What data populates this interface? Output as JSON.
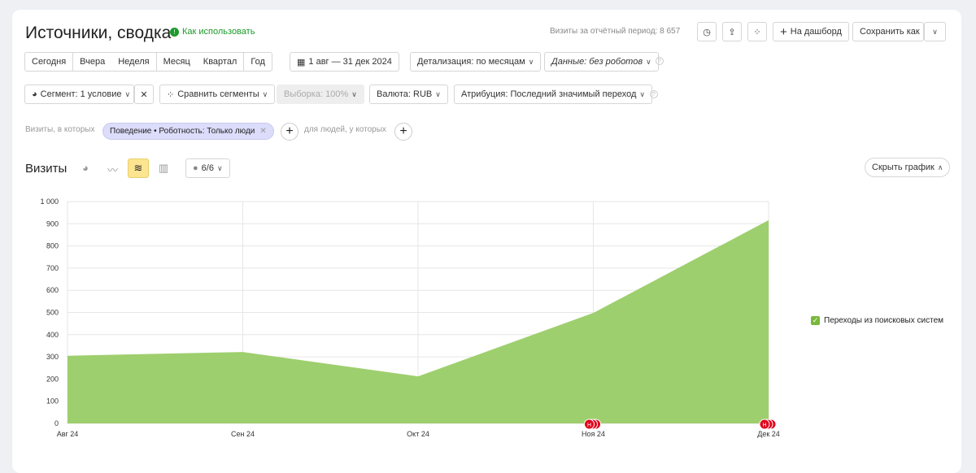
{
  "header": {
    "title": "Источники, сводка",
    "help_link": "Как использовать",
    "visits_total": "Визиты за отчётный период: 8 657",
    "to_dashboard": "На дашборд",
    "save_as": "Сохранить как"
  },
  "period": {
    "options": [
      "Сегодня",
      "Вчера",
      "Неделя",
      "Месяц",
      "Квартал",
      "Год"
    ],
    "date_range": "1 авг — 31 дек 2024",
    "detail": "Детализация: по месяцам",
    "data_filter": "Данные: без роботов"
  },
  "filters": {
    "segment": "Сегмент: 1 условие",
    "compare": "Сравнить сегменты",
    "sample": "Выборка: 100%",
    "currency": "Валюта: RUB",
    "attribution": "Атрибуция: Последний значимый переход"
  },
  "conditions": {
    "visits_label": "Визиты, в которых",
    "chip": "Поведение • Роботность: Только люди",
    "people_label": "для людей, у которых"
  },
  "chart_section": {
    "title": "Визиты",
    "annotations": "6/6",
    "hide_chart": "Скрыть график"
  },
  "colors": {
    "area": "#99cc66",
    "accent": "#fce490",
    "chip": "#dcdcfb",
    "marker": "#e0001a"
  },
  "chart_data": {
    "type": "area",
    "x": [
      "Авг 24",
      "Сен 24",
      "Окт 24",
      "Ноя 24",
      "Дек 24"
    ],
    "series": [
      {
        "name": "Переходы из поисковых систем",
        "values": [
          305,
          322,
          212,
          498,
          916
        ]
      }
    ],
    "ylim": [
      0,
      1000
    ],
    "yticks": [
      0,
      100,
      200,
      300,
      400,
      500,
      600,
      700,
      800,
      900,
      1000
    ],
    "grid": true,
    "legend": "right",
    "markers": [
      {
        "x": "Ноя 24",
        "label": "Н"
      },
      {
        "x": "Дек 24",
        "label": "Н"
      }
    ]
  }
}
